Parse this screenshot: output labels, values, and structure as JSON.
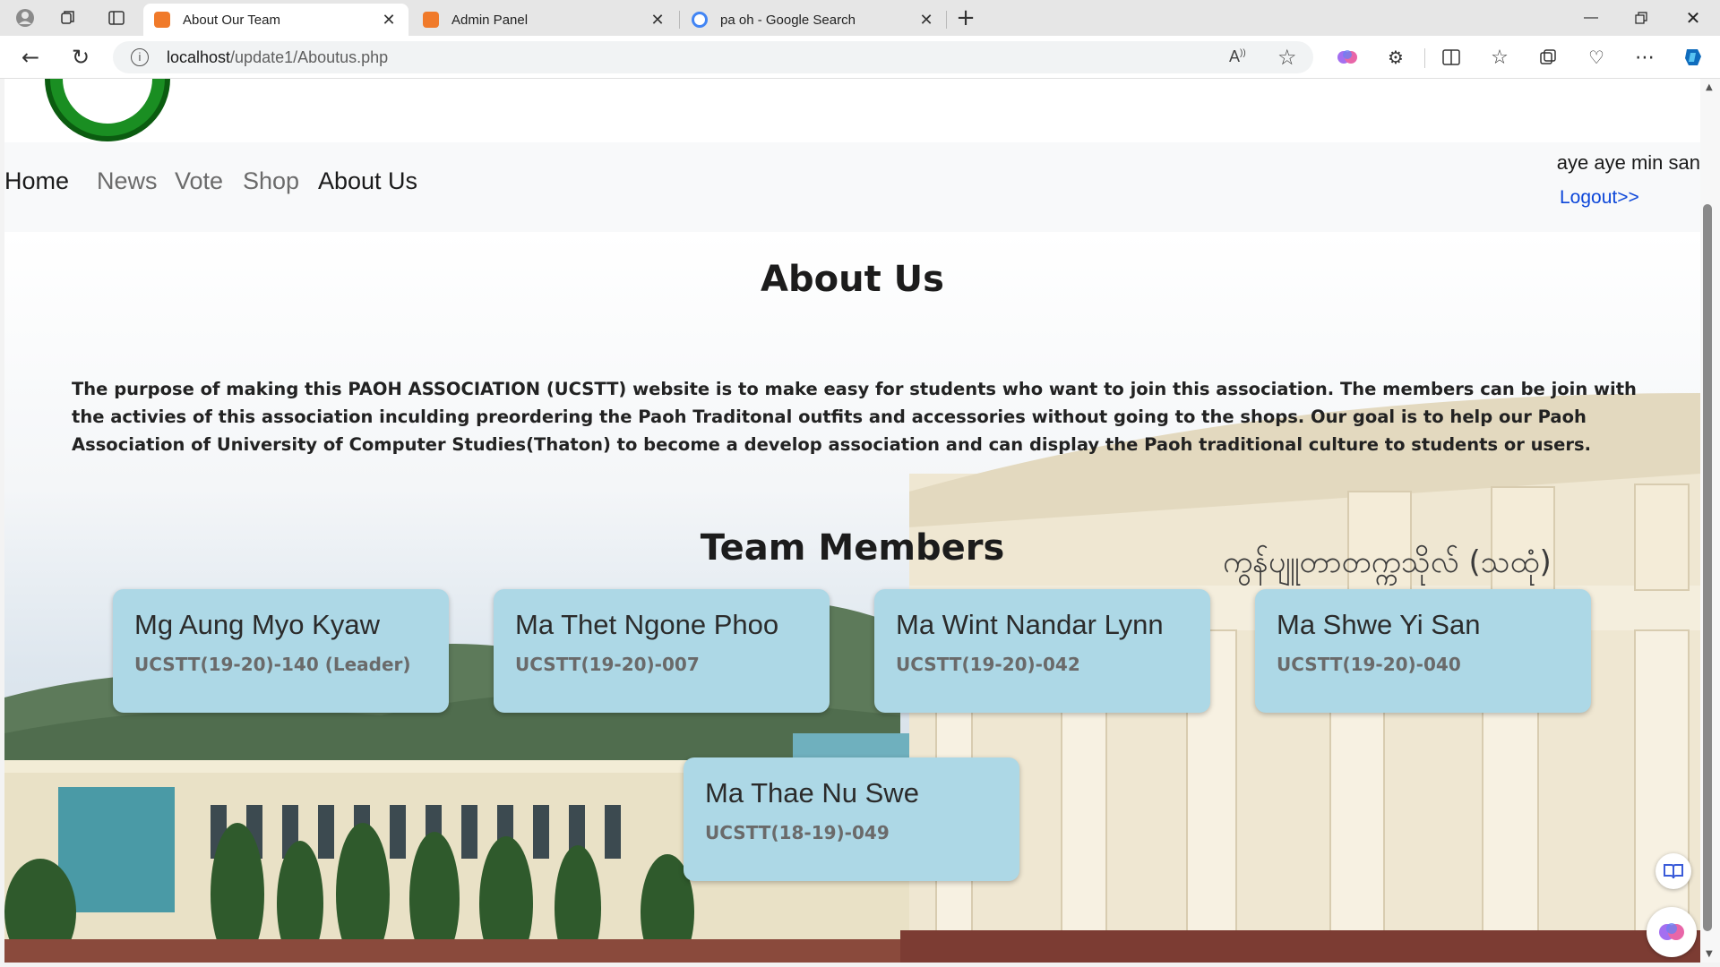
{
  "browser": {
    "tabs": [
      {
        "title": "About Our Team",
        "active": true
      },
      {
        "title": "Admin Panel",
        "active": false
      },
      {
        "title": "pa oh - Google Search",
        "active": false
      }
    ],
    "address": {
      "host": "localhost",
      "path": "/update1/Aboutus.php"
    },
    "colors": {
      "xampp_favicon": "#f07a2a",
      "edge_accent": "#0f6cbd"
    }
  },
  "nav": {
    "home": "Home",
    "news": "News",
    "vote": "Vote",
    "shop": "Shop",
    "about": "About Us",
    "user": "aye aye min san",
    "logout": "Logout>>"
  },
  "about": {
    "title": "About Us",
    "body": "The purpose of making this PAOH ASSOCIATION (UCSTT) website is to make easy for students who want to join this association. The members can be join with the activies of this association inculding preordering the Paoh Traditonal outfits and accessories without going to the shops. Our goal is to help our Paoh Association of University of Computer Studies(Thaton) to become a develop association and can display the Paoh traditional culture to students or users."
  },
  "team": {
    "title": "Team Members",
    "members": [
      {
        "name": "Mg Aung Myo Kyaw",
        "id": "UCSTT(19-20)-140 (Leader)"
      },
      {
        "name": "Ma Thet Ngone Phoo",
        "id": "UCSTT(19-20)-007"
      },
      {
        "name": "Ma Wint Nandar Lynn",
        "id": "UCSTT(19-20)-042"
      },
      {
        "name": "Ma Shwe Yi San",
        "id": "UCSTT(19-20)-040"
      },
      {
        "name": "Ma Thae Nu Swe",
        "id": "UCSTT(18-19)-049"
      }
    ],
    "card_color": "#add8e6"
  },
  "background_sign": "ကွန်ပျူတာတက္ကသိုလ် (သထုံ)"
}
